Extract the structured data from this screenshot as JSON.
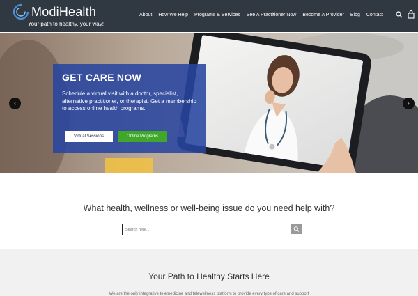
{
  "header": {
    "brand": "ModiHealth",
    "tagline": "Your path to healthy, your way!",
    "nav": [
      "About",
      "How We Help",
      "Programs & Services",
      "See A Practitioner Now",
      "Become A Provider",
      "Blog",
      "Contact"
    ],
    "background_color": "#303841",
    "icons": [
      "logo-ring-icon",
      "search-icon",
      "shopping-bag-icon"
    ]
  },
  "hero": {
    "title": "GET CARE NOW",
    "text": "Schedule a virtual visit with a doctor, specialist, alternative practitioner, or therapist. Get a membership to access online health programs.",
    "btn_virtual": "Virtual Sessions",
    "btn_online": "Online Programs",
    "box_color": "#2846a0",
    "online_color": "#3fa82b",
    "arrow_left": "‹",
    "arrow_right": "›"
  },
  "help": {
    "title": "What health, wellness or well-being issue do you need help with?",
    "search_placeholder": "Search here..."
  },
  "path": {
    "title": "Your Path to Healthy Starts Here",
    "text": "We are the only integrative telemedicine and telewellness platform to provide every type of care and support"
  }
}
